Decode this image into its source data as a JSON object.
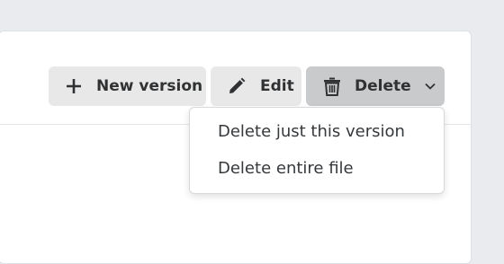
{
  "toolbar": {
    "new_version_label": "New version",
    "edit_label": "Edit",
    "delete_label": "Delete"
  },
  "delete_menu": {
    "items": [
      {
        "label": "Delete just this version"
      },
      {
        "label": "Delete entire file"
      }
    ]
  },
  "icons": {
    "new_version": "plus-icon",
    "edit": "pencil-icon",
    "delete": "trash-icon",
    "dropdown": "chevron-down-icon"
  },
  "colors": {
    "page_bg": "#e9ebee",
    "button_bg": "#e8e8e8",
    "button_active_bg": "#c9cacb",
    "text": "#2f3133"
  }
}
